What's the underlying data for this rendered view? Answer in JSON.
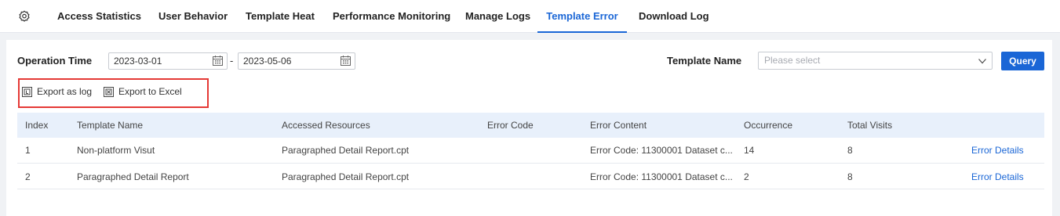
{
  "tabs": [
    {
      "label": "Access Statistics"
    },
    {
      "label": "User Behavior"
    },
    {
      "label": "Template Heat"
    },
    {
      "label": "Performance Monitoring"
    },
    {
      "label": "Manage Logs"
    },
    {
      "label": "Template Error"
    },
    {
      "label": "Download Log"
    }
  ],
  "active_tab": "Template Error",
  "filters": {
    "operation_time_label": "Operation Time",
    "start_date": "2023-03-01",
    "separator": "-",
    "end_date": "2023-05-06",
    "template_name_label": "Template Name",
    "template_name_placeholder": "Please select",
    "query_label": "Query"
  },
  "export": {
    "log_label": "Export as log",
    "excel_label": "Export to Excel"
  },
  "table": {
    "columns": [
      "Index",
      "Template Name",
      "Accessed Resources",
      "Error Code",
      "Error Content",
      "Occurrence",
      "Total Visits"
    ],
    "rows": [
      {
        "index": "1",
        "template_name": "Non-platform Visut",
        "accessed_resources": "Paragraphed Detail Report.cpt",
        "error_code": "",
        "error_content": "Error Code: 11300001 Dataset c...",
        "occurrence": "14",
        "total_visits": "8",
        "action": "Error Details"
      },
      {
        "index": "2",
        "template_name": "Paragraphed Detail Report",
        "accessed_resources": "Paragraphed Detail Report.cpt",
        "error_code": "",
        "error_content": "Error Code: 11300001 Dataset c...",
        "occurrence": "2",
        "total_visits": "8",
        "action": "Error Details"
      }
    ]
  },
  "colors": {
    "accent": "#1a66d6",
    "highlight_border": "#e53935",
    "table_header_bg": "#e8f0fb"
  }
}
